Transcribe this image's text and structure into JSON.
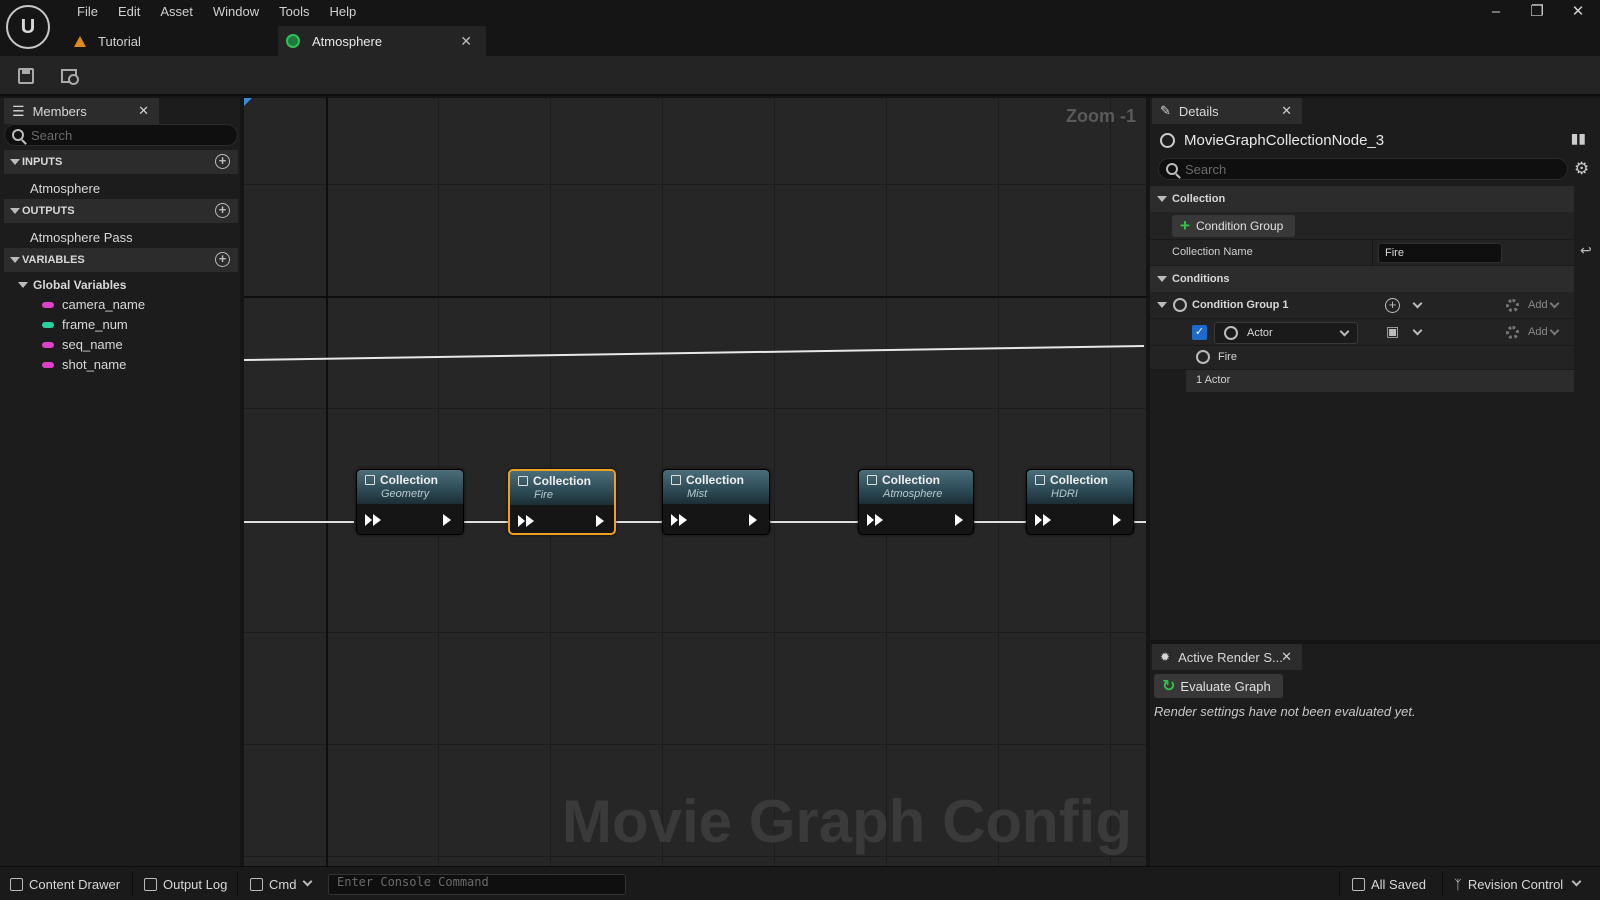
{
  "menu": {
    "items": [
      "File",
      "Edit",
      "Asset",
      "Window",
      "Tools",
      "Help"
    ]
  },
  "tabs": [
    {
      "label": "Tutorial",
      "icon": "warning-cone-icon"
    },
    {
      "label": "Atmosphere",
      "icon": "movie-graph-icon",
      "active": true
    }
  ],
  "members": {
    "title": "Members",
    "search_placeholder": "Search",
    "inputs_header": "INPUTS",
    "inputs": [
      "Atmosphere"
    ],
    "outputs_header": "OUTPUTS",
    "outputs": [
      "Atmosphere Pass"
    ],
    "variables_header": "VARIABLES",
    "global_variables_label": "Global Variables",
    "variables": [
      {
        "name": "camera_name",
        "color": "#e040c8"
      },
      {
        "name": "frame_num",
        "color": "#28d0a0"
      },
      {
        "name": "seq_name",
        "color": "#e040c8"
      },
      {
        "name": "shot_name",
        "color": "#e040c8"
      }
    ]
  },
  "graph": {
    "zoom": "Zoom -1",
    "watermark": "Movie Graph Config",
    "nodes": [
      {
        "title": "Collection",
        "subtitle": "Geometry",
        "selected": false
      },
      {
        "title": "Collection",
        "subtitle": "Fire",
        "selected": true
      },
      {
        "title": "Collection",
        "subtitle": "Mist",
        "selected": false
      },
      {
        "title": "Collection",
        "subtitle": "Atmosphere",
        "selected": false
      },
      {
        "title": "Collection",
        "subtitle": "HDRI",
        "selected": false
      }
    ],
    "colors": {
      "selection": "#f0a020",
      "node_header": "#3a5c68"
    }
  },
  "details": {
    "title": "Details",
    "node_name": "MovieGraphCollectionNode_3",
    "search_placeholder": "Search",
    "collection_category": "Collection",
    "condition_group_button": "Condition Group",
    "collection_name_label": "Collection Name",
    "collection_name_value": "Fire",
    "conditions_category": "Conditions",
    "condition_group_label": "Condition Group 1",
    "add_label": "Add",
    "query_type": "Actor",
    "query_result": "Fire",
    "match_count": "1 Actor"
  },
  "render": {
    "title": "Active Render S...",
    "evaluate_button": "Evaluate Graph",
    "message": "Render settings have not been evaluated yet."
  },
  "statusbar": {
    "content_drawer": "Content Drawer",
    "output_log": "Output Log",
    "cmd": "Cmd",
    "console_placeholder": "Enter Console Command",
    "all_saved": "All Saved",
    "revision_control": "Revision Control"
  }
}
